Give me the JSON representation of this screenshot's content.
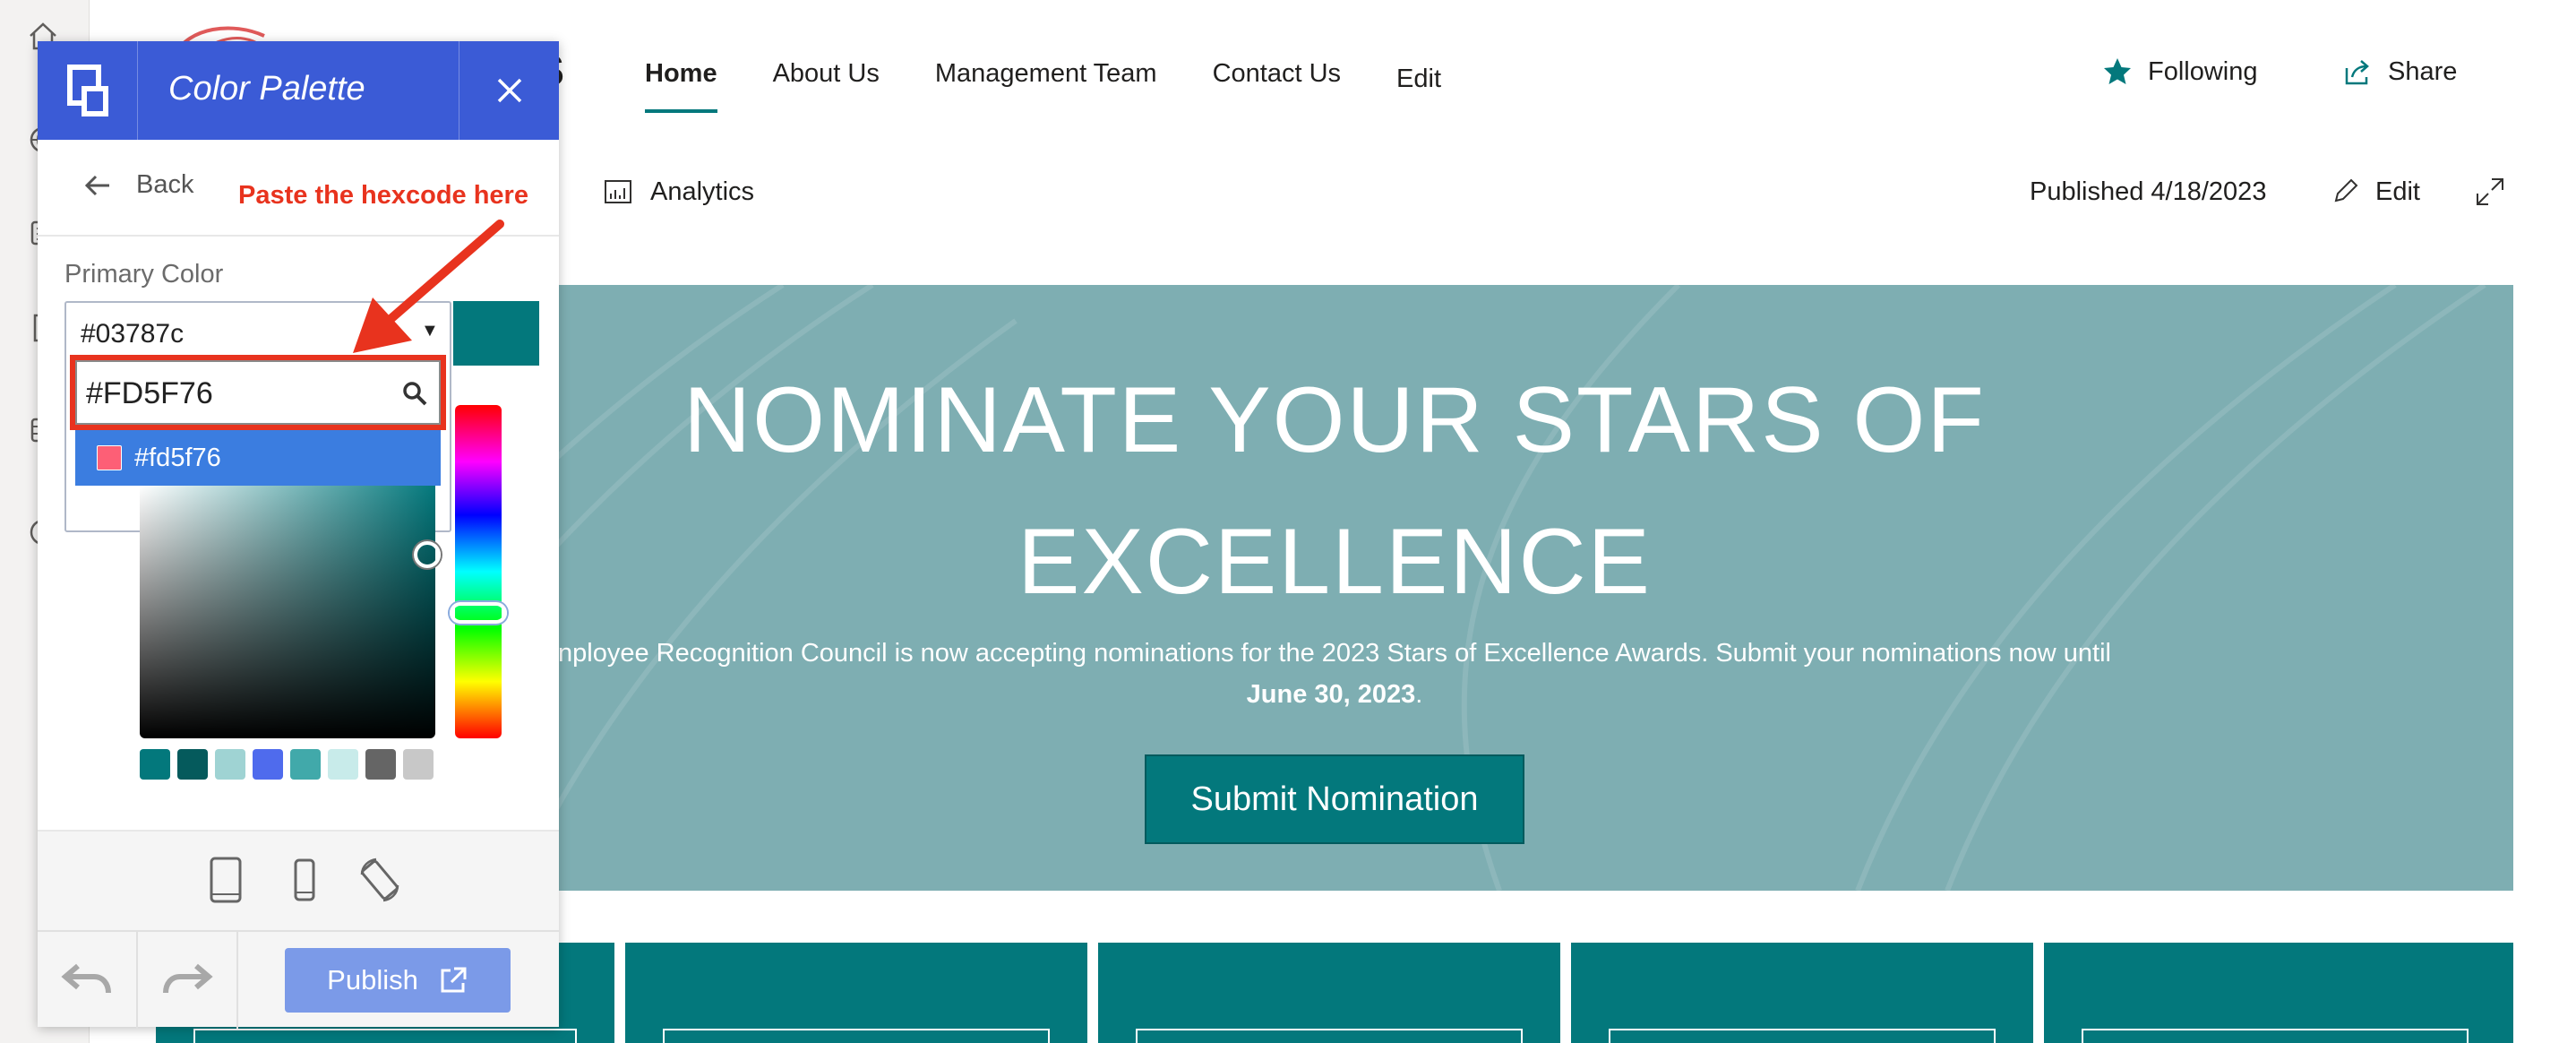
{
  "site": {
    "logo_letter": "S",
    "nav": [
      "Home",
      "About Us",
      "Management Team",
      "Contact Us",
      "Edit"
    ],
    "following_label": "Following",
    "share_label": "Share"
  },
  "commandbar": {
    "analytics_label": "Analytics",
    "published_label": "Published 4/18/2023",
    "edit_label": "Edit"
  },
  "hero": {
    "title_line1": "NOMINATE YOUR STARS OF",
    "title_line2": "EXCELLENCE",
    "description": "nployee Recognition Council is now accepting nominations for the 2023 Stars of Excellence Awards. Submit your nominations now until",
    "deadline": "June 30, 2023",
    "deadline_suffix": ".",
    "button_label": "Submit Nomination",
    "background_color": "#7eaeb2"
  },
  "panel": {
    "title": "Color Palette",
    "back_label": "Back",
    "primary_color_label": "Primary Color",
    "selected_value": "#03787c",
    "search_value": "#FD5F76",
    "option_label": "#fd5f76",
    "option_color": "#fd5f76",
    "preview_color": "#03787c",
    "header_color": "#3b5bd6",
    "preset_swatches": [
      "#03787c",
      "#055a5c",
      "#9fd3d3",
      "#4f6bed",
      "#41a9aa",
      "#c8ebea",
      "#656565",
      "#c8c8c8"
    ],
    "publish_label": "Publish"
  },
  "annotation": {
    "text": "Paste the hexcode here",
    "color": "#e8331e"
  },
  "theme": {
    "accent": "#03787c"
  }
}
